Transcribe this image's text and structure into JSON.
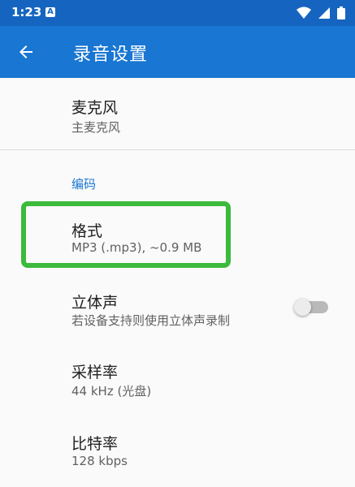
{
  "status_bar": {
    "time": "1:23",
    "notification_glyph": "A",
    "icons": [
      "wifi-icon",
      "signal-icon",
      "battery-icon"
    ]
  },
  "app_bar": {
    "title": "录音设置",
    "background": "#1976d2"
  },
  "prefs": {
    "microphone": {
      "title": "麦克风",
      "summary": "主麦克风"
    },
    "category_encoding": "编码",
    "format": {
      "title": "格式",
      "summary": "MP3 (.mp3), ~0.9 MB"
    },
    "stereo": {
      "title": "立体声",
      "summary": "若设备支持则使用立体声录制",
      "enabled": false
    },
    "sample_rate": {
      "title": "采样率",
      "summary": "44 kHz (光盘)"
    },
    "bit_rate": {
      "title": "比特率",
      "summary": "128 kbps"
    }
  },
  "colors": {
    "accent": "#1976d2",
    "status_bar": "#1565c0",
    "highlight": "#3cba3c"
  }
}
